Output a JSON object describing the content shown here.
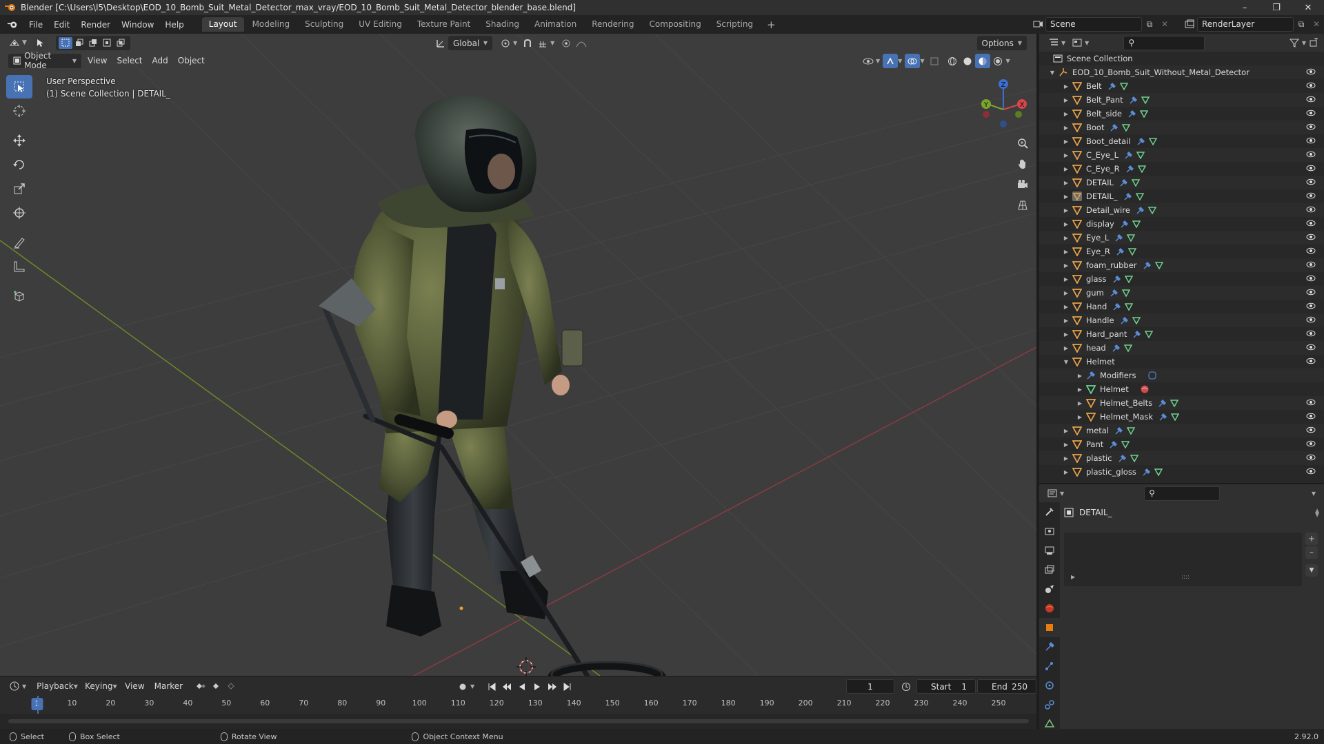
{
  "window": {
    "title": "Blender [C:\\Users\\l5\\Desktop\\EOD_10_Bomb_Suit_Metal_Detector_max_vray/EOD_10_Bomb_Suit_Metal_Detector_blender_base.blend]",
    "controls": [
      "minimize-icon",
      "maximize-icon",
      "close-icon"
    ]
  },
  "menu": [
    "File",
    "Edit",
    "Render",
    "Window",
    "Help"
  ],
  "workspaces": [
    {
      "label": "Layout",
      "active": true
    },
    {
      "label": "Modeling",
      "active": false
    },
    {
      "label": "Sculpting",
      "active": false
    },
    {
      "label": "UV Editing",
      "active": false
    },
    {
      "label": "Texture Paint",
      "active": false
    },
    {
      "label": "Shading",
      "active": false
    },
    {
      "label": "Animation",
      "active": false
    },
    {
      "label": "Rendering",
      "active": false
    },
    {
      "label": "Compositing",
      "active": false
    },
    {
      "label": "Scripting",
      "active": false
    }
  ],
  "topright": {
    "scene": "Scene",
    "view_layer": "RenderLayer"
  },
  "viewport": {
    "mode": "Object Mode",
    "menus": [
      "View",
      "Select",
      "Add",
      "Object"
    ],
    "transform_orientation": "Global",
    "options": "Options",
    "info_line1": "User Perspective",
    "info_line2": "(1) Scene Collection | DETAIL_",
    "gizmo_axes": [
      "X",
      "Y",
      "Z"
    ],
    "tools": [
      "select-box-icon",
      "cursor-icon",
      "move-icon",
      "rotate-icon",
      "scale-icon",
      "transform-icon",
      "annotate-icon",
      "measure-icon",
      "add-cube-icon"
    ],
    "colors": {
      "background": "#3d3d3d",
      "grid": "#474747",
      "axis_x": "#8a3b44",
      "axis_y": "#6c8a2a",
      "accent": "#4772b3"
    }
  },
  "timeline": {
    "menus": [
      "Playback",
      "Keying",
      "View",
      "Marker"
    ],
    "current_frame": "1",
    "start_label": "Start",
    "start": "1",
    "end_label": "End",
    "end": "250",
    "ticks": [
      "1",
      "10",
      "20",
      "30",
      "40",
      "50",
      "60",
      "70",
      "80",
      "90",
      "100",
      "110",
      "120",
      "130",
      "140",
      "150",
      "160",
      "170",
      "180",
      "190",
      "200",
      "210",
      "220",
      "230",
      "240",
      "250"
    ]
  },
  "statusbar": {
    "items": [
      {
        "label": "Select"
      },
      {
        "label": "Box Select"
      },
      {
        "label": "Rotate View"
      },
      {
        "label": "Object Context Menu"
      }
    ],
    "version": "2.92.0"
  },
  "outliner": {
    "root": "Scene Collection",
    "collection": "EOD_10_Bomb_Suit_Without_Metal_Detector",
    "objects": [
      {
        "name": "Belt"
      },
      {
        "name": "Belt_Pant"
      },
      {
        "name": "Belt_side"
      },
      {
        "name": "Boot"
      },
      {
        "name": "Boot_detail"
      },
      {
        "name": "C_Eye_L"
      },
      {
        "name": "C_Eye_R"
      },
      {
        "name": "DETAIL"
      },
      {
        "name": "DETAIL_"
      },
      {
        "name": "Detail_wire"
      },
      {
        "name": "display"
      },
      {
        "name": "Eye_L"
      },
      {
        "name": "Eye_R"
      },
      {
        "name": "foam_rubber"
      },
      {
        "name": "glass"
      },
      {
        "name": "gum"
      },
      {
        "name": "Hand"
      },
      {
        "name": "Handle"
      },
      {
        "name": "Hard_pant"
      },
      {
        "name": "head"
      },
      {
        "name": "Helmet"
      }
    ],
    "helmet_children": [
      {
        "name": "Modifiers",
        "kind": "modifiers"
      },
      {
        "name": "Helmet",
        "kind": "mesh"
      },
      {
        "name": "Helmet_Belts",
        "kind": "object"
      },
      {
        "name": "Helmet_Mask",
        "kind": "object"
      }
    ],
    "objects_after": [
      {
        "name": "metal"
      },
      {
        "name": "Pant"
      },
      {
        "name": "plastic"
      },
      {
        "name": "plastic_gloss"
      }
    ]
  },
  "properties": {
    "object_name": "DETAIL_"
  }
}
